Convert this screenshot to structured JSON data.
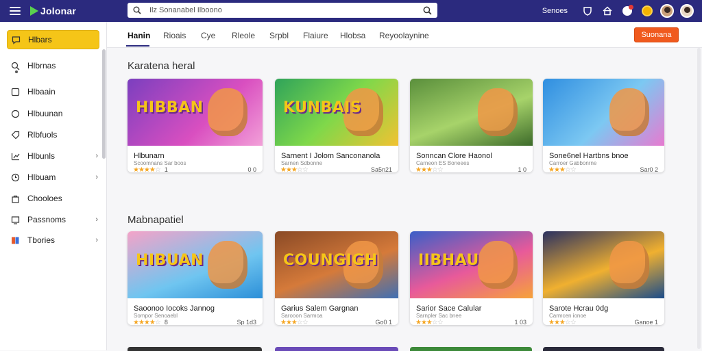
{
  "header": {
    "logo_text": "Jolonar",
    "search_placeholder": "Ilz Sonanabel Ilboono",
    "top_link": "Senoes",
    "brand_color": "#2b2a7e"
  },
  "sidebar": {
    "items": [
      {
        "label": "Hlbars",
        "icon": "chat-bubble-icon",
        "active": true
      },
      {
        "label": "Hlbrnas",
        "icon": "search-icon"
      },
      {
        "label": "Hlbaain",
        "icon": "square-icon"
      },
      {
        "label": "Hlbuunan",
        "icon": "circle-icon"
      },
      {
        "label": "Rlbfuols",
        "icon": "tag-icon"
      },
      {
        "label": "Hlbunls",
        "icon": "chart-icon",
        "chevron": "›"
      },
      {
        "label": "Hlbuam",
        "icon": "clock-icon",
        "chevron": "›"
      },
      {
        "label": "Chooloes",
        "icon": "bag-icon"
      },
      {
        "label": "Passnoms",
        "icon": "monitor-icon",
        "chevron": "›"
      },
      {
        "label": "Tbories",
        "icon": "book-icon",
        "chevron": "›"
      }
    ]
  },
  "tabs": [
    {
      "label": "Hanin",
      "active": true
    },
    {
      "label": "Rioais"
    },
    {
      "label": "Cye"
    },
    {
      "label": "Rleole"
    },
    {
      "label": "Srpbl"
    },
    {
      "label": "Flaiure"
    },
    {
      "label": "Hlobsa"
    },
    {
      "label": "Reyoolaynine"
    }
  ],
  "cta_label": "Suonana",
  "sections": [
    {
      "title": "Karatena heral",
      "cards": [
        {
          "art_text": "HIBBAN",
          "title": "Hlbunarn",
          "subtitle": "Scoomnans Sar boos",
          "rating": 4,
          "rating_text": "1",
          "meta": "0 0"
        },
        {
          "art_text": "KUNBAIS",
          "title": "Sarnent I Jolom Sanconanola",
          "subtitle": "Sarnen Sdbonne",
          "rating": 3,
          "rating_text": "",
          "meta": "Sa5n21"
        },
        {
          "art_text": "",
          "title": "Sonncan Clore Haonol",
          "subtitle": "Carneon ES Boneees",
          "rating": 3,
          "rating_text": "",
          "meta": "1 0"
        },
        {
          "art_text": "",
          "title": "Sone6nel Hartbns bnoe",
          "subtitle": "Carroer Gabbonrne",
          "rating": 3,
          "rating_text": "",
          "meta": "Sar0 2"
        }
      ]
    },
    {
      "title": "Mabnapatiel",
      "cards": [
        {
          "art_text": "HIBUAN",
          "title": "Saoonoo Iocoks Jannog",
          "subtitle": "Sompor Senoaebl",
          "rating": 4,
          "rating_text": "8",
          "meta": "Sp 1d3"
        },
        {
          "art_text": "COUNGIGH",
          "title": "Garius Salem Gargnan",
          "subtitle": "Sarooon Sarmoa",
          "rating": 3,
          "rating_text": "",
          "meta": "Go0 1"
        },
        {
          "art_text": "IIBHAU",
          "title": "Sarior Sace Calular",
          "subtitle": "Sarnpler Sac bnee",
          "rating": 3,
          "rating_text": "",
          "meta": "1 03"
        },
        {
          "art_text": "",
          "title": "Sarote Hcrau 0dg",
          "subtitle": "Carmcen ionoe",
          "rating": 3,
          "rating_text": "",
          "meta": "Ganoe 1"
        }
      ]
    }
  ]
}
